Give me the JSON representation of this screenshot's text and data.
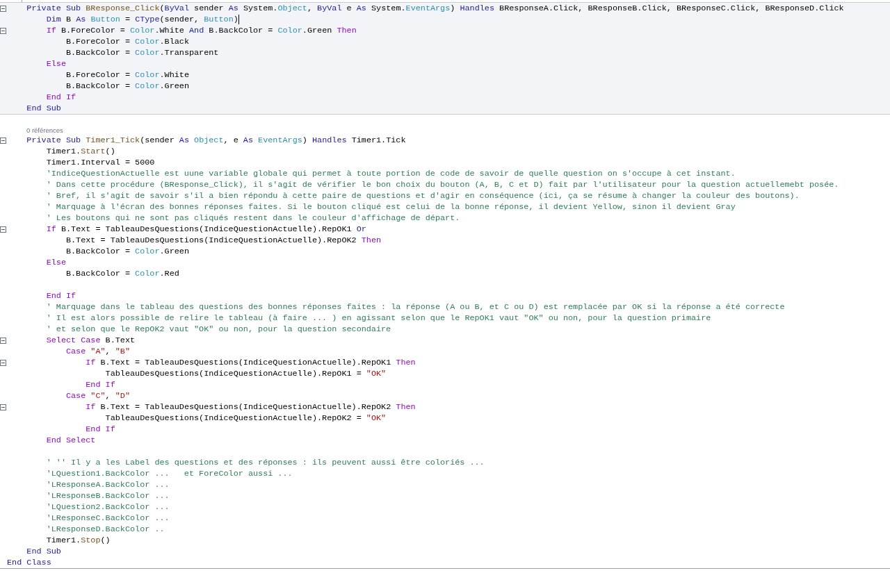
{
  "editor": {
    "blocks": [
      {
        "kind": "highlighted",
        "lines": [
          {
            "kind": "code",
            "caret": false,
            "fold": true,
            "tokens": [
              {
                "kind": "k",
                "text": "    Private Sub "
              },
              {
                "kind": "m",
                "text": "BResponse_Click"
              },
              {
                "kind": "p",
                "text": "("
              },
              {
                "kind": "k",
                "text": "ByVal"
              },
              {
                "kind": "p",
                "text": " sender "
              },
              {
                "kind": "k",
                "text": "As"
              },
              {
                "kind": "p",
                "text": " System."
              },
              {
                "kind": "t",
                "text": "Object"
              },
              {
                "kind": "p",
                "text": ", "
              },
              {
                "kind": "k",
                "text": "ByVal"
              },
              {
                "kind": "p",
                "text": " e "
              },
              {
                "kind": "k",
                "text": "As"
              },
              {
                "kind": "p",
                "text": " System."
              },
              {
                "kind": "t",
                "text": "EventArgs"
              },
              {
                "kind": "p",
                "text": ") "
              },
              {
                "kind": "k",
                "text": "Handles"
              },
              {
                "kind": "p",
                "text": " BResponseA.Click, BResponseB.Click, BResponseC.Click, BResponseD.Click"
              }
            ]
          },
          {
            "kind": "code",
            "caret": true,
            "fold": false,
            "tokens": [
              {
                "kind": "k",
                "text": "        Dim"
              },
              {
                "kind": "p",
                "text": " B "
              },
              {
                "kind": "k",
                "text": "As"
              },
              {
                "kind": "t",
                "text": " Button"
              },
              {
                "kind": "p",
                "text": " = "
              },
              {
                "kind": "k",
                "text": "CType"
              },
              {
                "kind": "p",
                "text": "(sender, "
              },
              {
                "kind": "t",
                "text": "Button"
              },
              {
                "kind": "p",
                "text": ")"
              }
            ]
          },
          {
            "kind": "code",
            "caret": false,
            "fold": true,
            "tokens": [
              {
                "kind": "c",
                "text": "        If"
              },
              {
                "kind": "p",
                "text": " B.ForeColor = "
              },
              {
                "kind": "t",
                "text": "Color"
              },
              {
                "kind": "p",
                "text": ".White "
              },
              {
                "kind": "k",
                "text": "And"
              },
              {
                "kind": "p",
                "text": " B.BackColor = "
              },
              {
                "kind": "t",
                "text": "Color"
              },
              {
                "kind": "p",
                "text": ".Green "
              },
              {
                "kind": "c",
                "text": "Then"
              }
            ]
          },
          {
            "kind": "code",
            "caret": false,
            "fold": false,
            "tokens": [
              {
                "kind": "p",
                "text": "            B.ForeColor = "
              },
              {
                "kind": "t",
                "text": "Color"
              },
              {
                "kind": "p",
                "text": ".Black"
              }
            ]
          },
          {
            "kind": "code",
            "caret": false,
            "fold": false,
            "tokens": [
              {
                "kind": "p",
                "text": "            B.BackColor = "
              },
              {
                "kind": "t",
                "text": "Color"
              },
              {
                "kind": "p",
                "text": ".Transparent"
              }
            ]
          },
          {
            "kind": "code",
            "caret": false,
            "fold": false,
            "tokens": [
              {
                "kind": "c",
                "text": "        Else"
              }
            ]
          },
          {
            "kind": "code",
            "caret": false,
            "fold": false,
            "tokens": [
              {
                "kind": "p",
                "text": "            B.ForeColor = "
              },
              {
                "kind": "t",
                "text": "Color"
              },
              {
                "kind": "p",
                "text": ".White"
              }
            ]
          },
          {
            "kind": "code",
            "caret": false,
            "fold": false,
            "tokens": [
              {
                "kind": "p",
                "text": "            B.BackColor = "
              },
              {
                "kind": "t",
                "text": "Color"
              },
              {
                "kind": "p",
                "text": ".Green"
              }
            ]
          },
          {
            "kind": "code",
            "caret": false,
            "fold": false,
            "tokens": [
              {
                "kind": "c",
                "text": "        End If"
              }
            ]
          },
          {
            "kind": "code",
            "caret": false,
            "fold": false,
            "tokens": [
              {
                "kind": "k",
                "text": "    End Sub"
              }
            ]
          }
        ]
      },
      {
        "kind": "plain",
        "lines": [
          {
            "kind": "blank"
          },
          {
            "kind": "codelens",
            "text": "0 références"
          },
          {
            "kind": "code",
            "caret": false,
            "fold": true,
            "tokens": [
              {
                "kind": "k",
                "text": "    Private Sub "
              },
              {
                "kind": "m",
                "text": "Timer1_Tick"
              },
              {
                "kind": "p",
                "text": "(sender "
              },
              {
                "kind": "k",
                "text": "As"
              },
              {
                "kind": "t",
                "text": " Object"
              },
              {
                "kind": "p",
                "text": ", e "
              },
              {
                "kind": "k",
                "text": "As"
              },
              {
                "kind": "t",
                "text": " EventArgs"
              },
              {
                "kind": "p",
                "text": ") "
              },
              {
                "kind": "k",
                "text": "Handles"
              },
              {
                "kind": "p",
                "text": " Timer1.Tick"
              }
            ]
          },
          {
            "kind": "code",
            "caret": false,
            "fold": false,
            "tokens": [
              {
                "kind": "p",
                "text": "        Timer1."
              },
              {
                "kind": "m",
                "text": "Start"
              },
              {
                "kind": "p",
                "text": "()"
              }
            ]
          },
          {
            "kind": "code",
            "caret": false,
            "fold": false,
            "tokens": [
              {
                "kind": "p",
                "text": "        Timer1.Interval = 5000"
              }
            ]
          },
          {
            "kind": "code",
            "caret": false,
            "fold": false,
            "tokens": [
              {
                "kind": "g",
                "text": "        'IndiceQuestionActuelle est uune variable globale qui permet à toute portion de code de savoir de quelle question on s'occupe à cet instant."
              }
            ]
          },
          {
            "kind": "code",
            "caret": false,
            "fold": false,
            "tokens": [
              {
                "kind": "g",
                "text": "        ' Dans cette procédure (BResponse_Click), il s'agit de vérifier le bon choix du bouton (A, B, C et D) fait par l'utilisateur pour la question actuellemebt posée."
              }
            ]
          },
          {
            "kind": "code",
            "caret": false,
            "fold": false,
            "tokens": [
              {
                "kind": "g",
                "text": "        ' Bref, il s'agit de savoir s'il a bien répondu à cette paire de questions et d'agir en conséquence (ici, ça se résume à changer la couleur des boutons)."
              }
            ]
          },
          {
            "kind": "code",
            "caret": false,
            "fold": false,
            "tokens": [
              {
                "kind": "g",
                "text": "        ' Marquage à l'écran des bonnes réponses faites. Si le bouton cliqué est celui de la bonne réponse, il devient Yellow, sinon il devient Gray"
              }
            ]
          },
          {
            "kind": "code",
            "caret": false,
            "fold": false,
            "tokens": [
              {
                "kind": "g",
                "text": "        ' Les boutons qui ne sont pas cliqués restent dans le couleur d'affichage de départ."
              }
            ]
          },
          {
            "kind": "code",
            "caret": false,
            "fold": true,
            "tokens": [
              {
                "kind": "c",
                "text": "        If"
              },
              {
                "kind": "p",
                "text": " B.Text = TableauDesQuestions(IndiceQuestionActuelle).RepOK1 "
              },
              {
                "kind": "k",
                "text": "Or"
              }
            ]
          },
          {
            "kind": "code",
            "caret": false,
            "fold": false,
            "tokens": [
              {
                "kind": "p",
                "text": "            B.Text = TableauDesQuestions(IndiceQuestionActuelle).RepOK2 "
              },
              {
                "kind": "c",
                "text": "Then"
              }
            ]
          },
          {
            "kind": "code",
            "caret": false,
            "fold": false,
            "tokens": [
              {
                "kind": "p",
                "text": "            B.BackColor = "
              },
              {
                "kind": "t",
                "text": "Color"
              },
              {
                "kind": "p",
                "text": ".Green"
              }
            ]
          },
          {
            "kind": "code",
            "caret": false,
            "fold": false,
            "tokens": [
              {
                "kind": "c",
                "text": "        Else"
              }
            ]
          },
          {
            "kind": "code",
            "caret": false,
            "fold": false,
            "tokens": [
              {
                "kind": "p",
                "text": "            B.BackColor = "
              },
              {
                "kind": "t",
                "text": "Color"
              },
              {
                "kind": "p",
                "text": ".Red"
              }
            ]
          },
          {
            "kind": "blank"
          },
          {
            "kind": "code",
            "caret": false,
            "fold": false,
            "tokens": [
              {
                "kind": "c",
                "text": "        End If"
              }
            ]
          },
          {
            "kind": "code",
            "caret": false,
            "fold": false,
            "tokens": [
              {
                "kind": "g",
                "text": "        ' Marquage dans le tableau des questions des bonnes réponses faites : la réponse (A ou B, et C ou D) est remplacée par OK si la réponse a été correcte"
              }
            ]
          },
          {
            "kind": "code",
            "caret": false,
            "fold": false,
            "tokens": [
              {
                "kind": "g",
                "text": "        ' Il est alors possible de relire le tableau (à faire ... ) en agissant selon que le RepOK1 vaut \"OK\" ou non, pour la question primaire"
              }
            ]
          },
          {
            "kind": "code",
            "caret": false,
            "fold": false,
            "tokens": [
              {
                "kind": "g",
                "text": "        ' et selon que le RepOK2 vaut \"OK\" ou non, pour la question secondaire"
              }
            ]
          },
          {
            "kind": "code",
            "caret": false,
            "fold": true,
            "tokens": [
              {
                "kind": "c",
                "text": "        Select Case"
              },
              {
                "kind": "p",
                "text": " B.Text"
              }
            ]
          },
          {
            "kind": "code",
            "caret": false,
            "fold": false,
            "tokens": [
              {
                "kind": "c",
                "text": "            Case"
              },
              {
                "kind": "s",
                "text": " \"A\""
              },
              {
                "kind": "p",
                "text": ", "
              },
              {
                "kind": "s",
                "text": "\"B\""
              }
            ]
          },
          {
            "kind": "code",
            "caret": false,
            "fold": true,
            "tokens": [
              {
                "kind": "c",
                "text": "                If"
              },
              {
                "kind": "p",
                "text": " B.Text = TableauDesQuestions(IndiceQuestionActuelle).RepOK1 "
              },
              {
                "kind": "c",
                "text": "Then"
              }
            ]
          },
          {
            "kind": "code",
            "caret": false,
            "fold": false,
            "tokens": [
              {
                "kind": "p",
                "text": "                    TableauDesQuestions(IndiceQuestionActuelle).RepOK1 = "
              },
              {
                "kind": "s",
                "text": "\"OK\""
              }
            ]
          },
          {
            "kind": "code",
            "caret": false,
            "fold": false,
            "tokens": [
              {
                "kind": "c",
                "text": "                End If"
              }
            ]
          },
          {
            "kind": "code",
            "caret": false,
            "fold": false,
            "tokens": [
              {
                "kind": "c",
                "text": "            Case"
              },
              {
                "kind": "s",
                "text": " \"C\""
              },
              {
                "kind": "p",
                "text": ", "
              },
              {
                "kind": "s",
                "text": "\"D\""
              }
            ]
          },
          {
            "kind": "code",
            "caret": false,
            "fold": true,
            "tokens": [
              {
                "kind": "c",
                "text": "                If"
              },
              {
                "kind": "p",
                "text": " B.Text = TableauDesQuestions(IndiceQuestionActuelle).RepOK2 "
              },
              {
                "kind": "c",
                "text": "Then"
              }
            ]
          },
          {
            "kind": "code",
            "caret": false,
            "fold": false,
            "tokens": [
              {
                "kind": "p",
                "text": "                    TableauDesQuestions(IndiceQuestionActuelle).RepOK2 = "
              },
              {
                "kind": "s",
                "text": "\"OK\""
              }
            ]
          },
          {
            "kind": "code",
            "caret": false,
            "fold": false,
            "tokens": [
              {
                "kind": "c",
                "text": "                End If"
              }
            ]
          },
          {
            "kind": "code",
            "caret": false,
            "fold": false,
            "tokens": [
              {
                "kind": "c",
                "text": "        End Select"
              }
            ]
          },
          {
            "kind": "blank"
          },
          {
            "kind": "code",
            "caret": false,
            "fold": false,
            "tokens": [
              {
                "kind": "g",
                "text": "        ' '' Il y a les Label des questions et des réponses : ils peuvent aussi être coloriés ..."
              }
            ]
          },
          {
            "kind": "code",
            "caret": false,
            "fold": false,
            "tokens": [
              {
                "kind": "g",
                "text": "        'LQuestion1.BackColor ...   et ForeColor aussi ..."
              }
            ]
          },
          {
            "kind": "code",
            "caret": false,
            "fold": false,
            "tokens": [
              {
                "kind": "g",
                "text": "        'LResponseA.BackColor ..."
              }
            ]
          },
          {
            "kind": "code",
            "caret": false,
            "fold": false,
            "tokens": [
              {
                "kind": "g",
                "text": "        'LResponseB.BackColor ..."
              }
            ]
          },
          {
            "kind": "code",
            "caret": false,
            "fold": false,
            "tokens": [
              {
                "kind": "g",
                "text": "        'LQuestion2.BackColor ..."
              }
            ]
          },
          {
            "kind": "code",
            "caret": false,
            "fold": false,
            "tokens": [
              {
                "kind": "g",
                "text": "        'LResponseC.BackColor ..."
              }
            ]
          },
          {
            "kind": "code",
            "caret": false,
            "fold": false,
            "tokens": [
              {
                "kind": "g",
                "text": "        'LResponseD.BackColor .."
              }
            ]
          },
          {
            "kind": "code",
            "caret": false,
            "fold": false,
            "tokens": [
              {
                "kind": "p",
                "text": "        Timer1."
              },
              {
                "kind": "m",
                "text": "Stop"
              },
              {
                "kind": "p",
                "text": "()"
              }
            ]
          },
          {
            "kind": "code",
            "caret": false,
            "fold": false,
            "tokens": [
              {
                "kind": "k",
                "text": "    End Sub"
              }
            ]
          },
          {
            "kind": "code",
            "caret": false,
            "fold": false,
            "tokens": [
              {
                "kind": "k",
                "text": "End Class"
              }
            ]
          }
        ]
      }
    ]
  }
}
